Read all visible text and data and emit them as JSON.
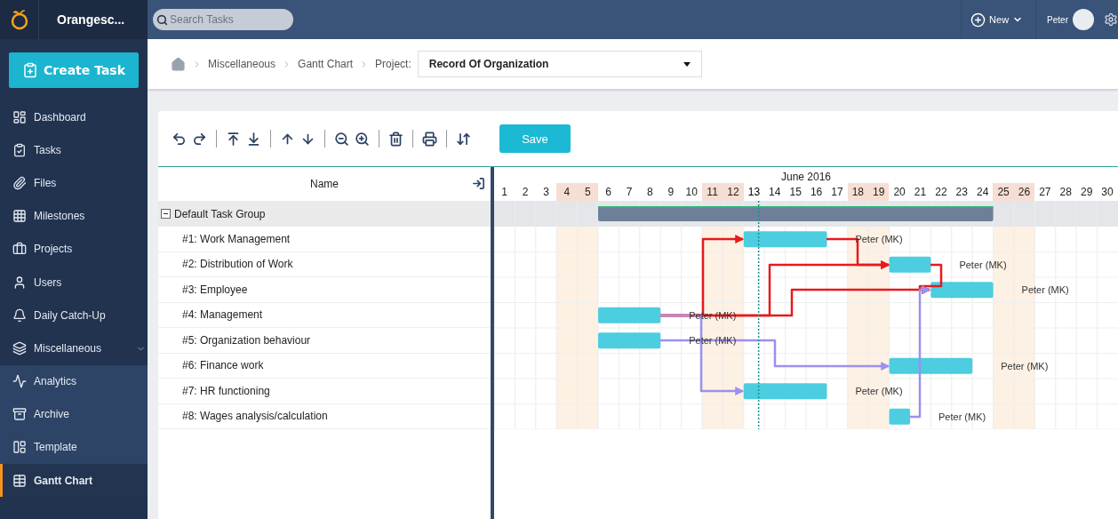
{
  "sidebar": {
    "brand": "Orangesc...",
    "create_button": "Create Task",
    "items": [
      {
        "label": "Dashboard",
        "selected": false
      },
      {
        "label": "Tasks",
        "selected": false
      },
      {
        "label": "Files",
        "selected": false
      },
      {
        "label": "Milestones",
        "selected": false
      },
      {
        "label": "Projects",
        "selected": false
      },
      {
        "label": "Users",
        "selected": false
      },
      {
        "label": "Daily Catch-Up",
        "selected": false
      },
      {
        "label": "Miscellaneous",
        "selected": false,
        "expanded": true,
        "children": [
          {
            "label": "Analytics",
            "selected": false
          },
          {
            "label": "Archive",
            "selected": false
          },
          {
            "label": "Template",
            "selected": false
          },
          {
            "label": "Gantt Chart",
            "selected": true
          }
        ]
      }
    ]
  },
  "topbar": {
    "search_placeholder": "Search Tasks",
    "new_button": "New",
    "user_name": "Peter"
  },
  "breadcrumb": {
    "items": [
      "Miscellaneous",
      "Gantt Chart"
    ],
    "project_label": "Project:",
    "project_value": "Record Of Organization"
  },
  "toolbar": {
    "save_button": "Save"
  },
  "gantt": {
    "name_header": "Name",
    "month": "June 2016",
    "days": [
      {
        "label": "1",
        "weekend": false,
        "today": false
      },
      {
        "label": "2",
        "weekend": false,
        "today": false
      },
      {
        "label": "3",
        "weekend": false,
        "today": false
      },
      {
        "label": "4",
        "weekend": true,
        "today": false
      },
      {
        "label": "5",
        "weekend": true,
        "today": false
      },
      {
        "label": "6",
        "weekend": false,
        "today": false
      },
      {
        "label": "7",
        "weekend": false,
        "today": false
      },
      {
        "label": "8",
        "weekend": false,
        "today": false
      },
      {
        "label": "9",
        "weekend": false,
        "today": false
      },
      {
        "label": "10",
        "weekend": false,
        "today": false
      },
      {
        "label": "11",
        "weekend": true,
        "today": false
      },
      {
        "label": "12",
        "weekend": true,
        "today": false
      },
      {
        "label": "13",
        "weekend": false,
        "today": true
      },
      {
        "label": "14",
        "weekend": false,
        "today": false
      },
      {
        "label": "15",
        "weekend": false,
        "today": false
      },
      {
        "label": "16",
        "weekend": false,
        "today": false
      },
      {
        "label": "17",
        "weekend": false,
        "today": false
      },
      {
        "label": "18",
        "weekend": true,
        "today": false
      },
      {
        "label": "19",
        "weekend": true,
        "today": false
      },
      {
        "label": "20",
        "weekend": false,
        "today": false
      },
      {
        "label": "21",
        "weekend": false,
        "today": false
      },
      {
        "label": "22",
        "weekend": false,
        "today": false
      },
      {
        "label": "23",
        "weekend": false,
        "today": false
      },
      {
        "label": "24",
        "weekend": false,
        "today": false
      },
      {
        "label": "25",
        "weekend": true,
        "today": false
      },
      {
        "label": "26",
        "weekend": true,
        "today": false
      },
      {
        "label": "27",
        "weekend": false,
        "today": false
      },
      {
        "label": "28",
        "weekend": false,
        "today": false
      },
      {
        "label": "29",
        "weekend": false,
        "today": false
      },
      {
        "label": "30",
        "weekend": false,
        "today": false
      }
    ],
    "group": {
      "name": "Default Task Group",
      "expanded": true
    },
    "tasks": [
      {
        "name": "#1: Work Management",
        "assignee": "Peter (MK)"
      },
      {
        "name": "#2: Distribution of Work",
        "assignee": "Peter (MK)"
      },
      {
        "name": "#3: Employee",
        "assignee": "Peter (MK)"
      },
      {
        "name": "#4: Management",
        "assignee": "Peter (MK)"
      },
      {
        "name": "#5: Organization behaviour",
        "assignee": "Peter (MK)"
      },
      {
        "name": "#6: Finance work",
        "assignee": "Peter (MK)"
      },
      {
        "name": "#7: HR functioning",
        "assignee": "Peter (MK)"
      },
      {
        "name": "#8: Wages analysis/calculation",
        "assignee": "Peter (MK)"
      }
    ]
  }
}
